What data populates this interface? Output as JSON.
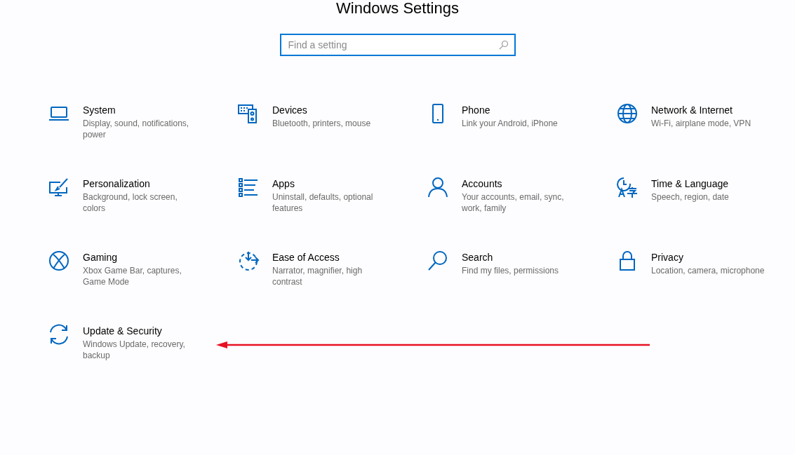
{
  "window": {
    "title": "Windows Settings"
  },
  "search": {
    "placeholder": "Find a setting"
  },
  "categories": [
    {
      "title": "System",
      "description": "Display, sound, notifications, power"
    },
    {
      "title": "Devices",
      "description": "Bluetooth, printers, mouse"
    },
    {
      "title": "Phone",
      "description": "Link your Android, iPhone"
    },
    {
      "title": "Network & Internet",
      "description": "Wi-Fi, airplane mode, VPN"
    },
    {
      "title": "Personalization",
      "description": "Background, lock screen, colors"
    },
    {
      "title": "Apps",
      "description": "Uninstall, defaults, optional features"
    },
    {
      "title": "Accounts",
      "description": "Your accounts, email, sync, work, family"
    },
    {
      "title": "Time & Language",
      "description": "Speech, region, date"
    },
    {
      "title": "Gaming",
      "description": "Xbox Game Bar, captures, Game Mode"
    },
    {
      "title": "Ease of Access",
      "description": "Narrator, magnifier, high contrast"
    },
    {
      "title": "Search",
      "description": "Find my files, permissions"
    },
    {
      "title": "Privacy",
      "description": "Location, camera, microphone"
    },
    {
      "title": "Update & Security",
      "description": "Windows Update, recovery, backup"
    }
  ]
}
